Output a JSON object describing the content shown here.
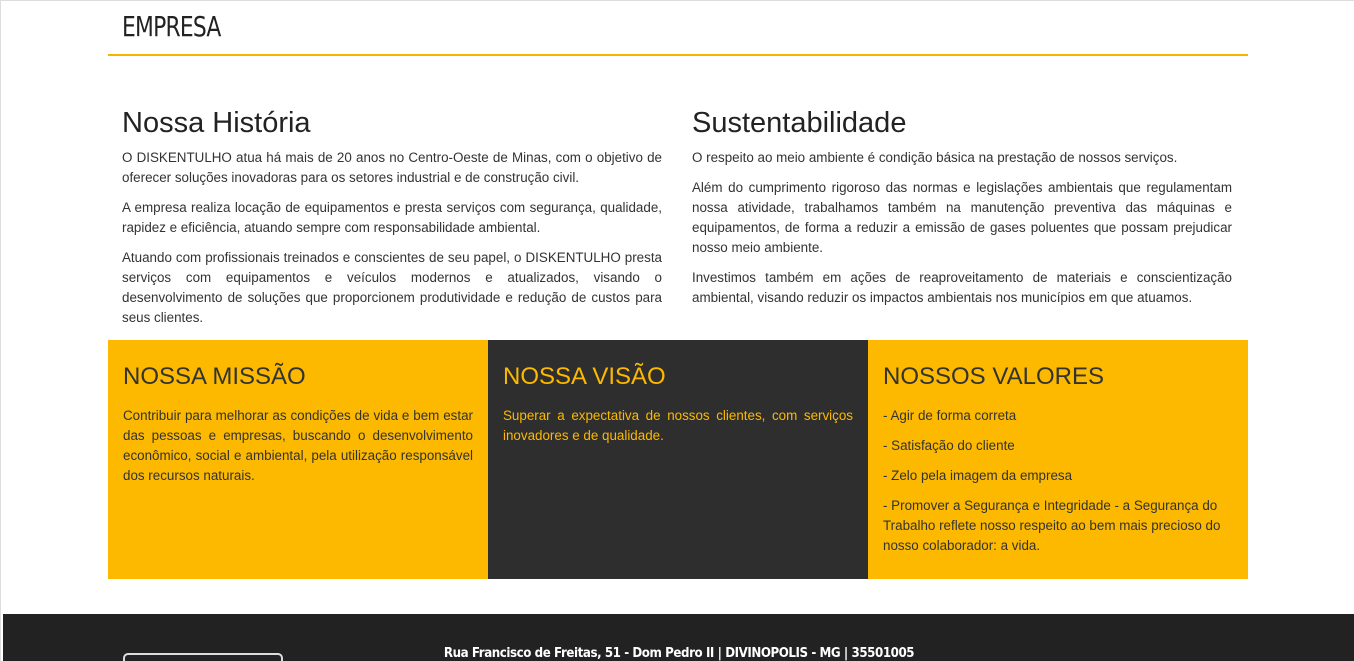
{
  "page": {
    "title": "EMPRESA"
  },
  "historia": {
    "heading": "Nossa História",
    "paragraphs": [
      "O DISKENTULHO atua há mais de 20 anos no Centro-Oeste de Minas, com o objetivo de oferecer soluções inovadoras para os setores industrial e de construção civil.",
      "A empresa realiza locação de equipamentos e presta serviços com segurança, qualidade, rapidez e eficiência, atuando sempre com responsabilidade ambiental.",
      "Atuando com profissionais treinados e conscientes de seu papel, o DISKENTULHO presta serviços com equipamentos e veículos modernos e atualizados, visando o desenvolvimento de soluções que proporcionem produtividade e redução de custos para seus clientes."
    ]
  },
  "sustentabilidade": {
    "heading": "Sustentabilidade",
    "paragraphs": [
      "O respeito ao meio ambiente é condição básica na prestação de nossos serviços.",
      "Além do cumprimento rigoroso das normas e legislações ambientais que regulamentam nossa atividade, trabalhamos também na manutenção preventiva das máquinas e equipamentos, de forma a reduzir a emissão de gases poluentes que possam prejudicar nosso meio ambiente.",
      "Investimos também em ações de reaproveitamento de materiais e conscientização ambiental, visando reduzir os impactos ambientais nos municípios em que atuamos."
    ]
  },
  "missao": {
    "heading": "NOSSA MISSÃO",
    "text": "Contribuir para melhorar as condições de vida e bem estar das pessoas e empresas, buscando o desenvolvimento econômico, social e ambiental, pela utilização responsável dos recursos naturais."
  },
  "visao": {
    "heading": "NOSSA VISÃO",
    "text": "Superar a expectativa de nossos clientes, com serviços inovadores e de qualidade."
  },
  "valores": {
    "heading": "NOSSOS VALORES",
    "items": [
      "- Agir de forma correta",
      "- Satisfação do cliente",
      "- Zelo pela imagem da empresa",
      "- Promover a Segurança e Integridade - a Segurança do Trabalho reflete nosso respeito ao bem mais precioso do nosso colaborador: a vida."
    ]
  },
  "footer": {
    "address": "Rua Francisco de Freitas, 51 - Dom Pedro II | DIVINOPOLIS - MG | 35501005"
  },
  "colors": {
    "accent": "#fcb900",
    "dark": "#2e2e2e",
    "footer": "#222222"
  }
}
